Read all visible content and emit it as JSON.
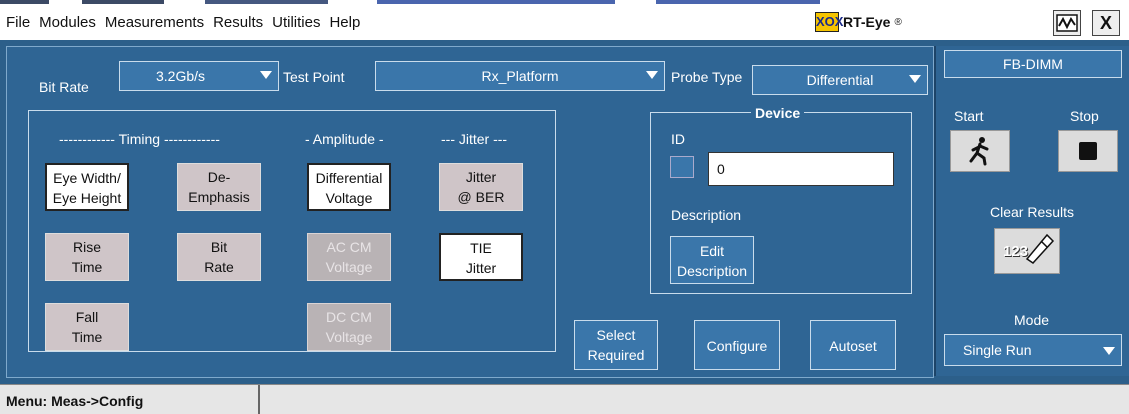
{
  "menubar": {
    "items": [
      "File",
      "Modules",
      "Measurements",
      "Results",
      "Utilities",
      "Help"
    ],
    "logo_mark": "XOX",
    "logo_text": "RT-Eye",
    "logo_reg": "®",
    "close_label": "X"
  },
  "settings": {
    "bit_rate_label": "Bit Rate",
    "bit_rate_value": "3.2Gb/s",
    "test_point_label": "Test Point",
    "test_point_value": "Rx_Platform",
    "probe_type_label": "Probe Type",
    "probe_type_value": "Differential"
  },
  "measurements": {
    "timing_header": "------------ Timing ------------",
    "amplitude_header": "- Amplitude -",
    "jitter_header": "--- Jitter ---",
    "eye_width_l1": "Eye Width/",
    "eye_width_l2": "Eye Height",
    "de_emphasis_l1": "De-",
    "de_emphasis_l2": "Emphasis",
    "diff_voltage_l1": "Differential",
    "diff_voltage_l2": "Voltage",
    "jitter_ber_l1": "Jitter",
    "jitter_ber_l2": "@ BER",
    "rise_time_l1": "Rise",
    "rise_time_l2": "Time",
    "bit_rate_l1": "Bit",
    "bit_rate_l2": "Rate",
    "ac_cm_l1": "AC CM",
    "ac_cm_l2": "Voltage",
    "tie_l1": "TIE",
    "tie_l2": "Jitter",
    "fall_time_l1": "Fall",
    "fall_time_l2": "Time",
    "dc_cm_l1": "DC CM",
    "dc_cm_l2": "Voltage"
  },
  "device": {
    "title": "Device",
    "id_label": "ID",
    "id_value": "0",
    "description_label": "Description",
    "edit_l1": "Edit",
    "edit_l2": "Description"
  },
  "actions": {
    "select_l1": "Select",
    "select_l2": "Required",
    "configure": "Configure",
    "autoset": "Autoset"
  },
  "side": {
    "module": "FB-DIMM",
    "start": "Start",
    "stop": "Stop",
    "clear_results": "Clear Results",
    "clear_icon_text": "123",
    "mode_label": "Mode",
    "mode_value": "Single Run"
  },
  "status": {
    "message": "Menu: Meas->Config"
  }
}
